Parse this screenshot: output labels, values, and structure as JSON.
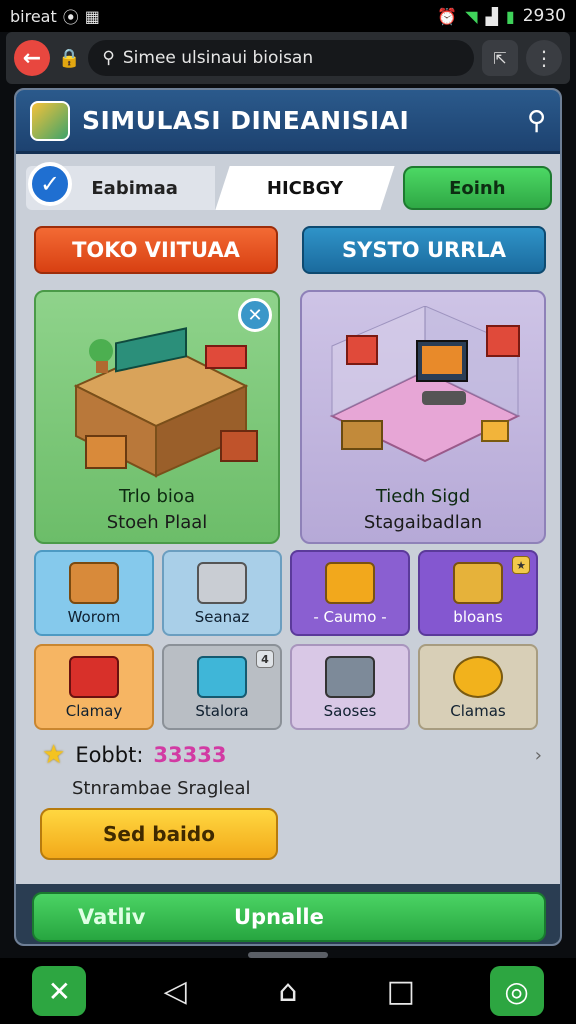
{
  "status_bar": {
    "carrier": "bireat",
    "time": "2930"
  },
  "browser": {
    "url": "Simee ulsinaui bioisan"
  },
  "app": {
    "title": "SIMULASI DINEANISIAI",
    "tabs": [
      "Eabimaa",
      "HICBGY",
      "Eoinh"
    ],
    "categories": [
      "TOKO VIITUAA",
      "SYSTO URRLA"
    ],
    "big_cards": [
      {
        "title": "Trlo bioa",
        "subtitle": "Stoeh Plaal"
      },
      {
        "title": "Tiedh Sigd",
        "subtitle": "Stagaibadlan"
      }
    ],
    "tiles": [
      {
        "label": "Worom"
      },
      {
        "label": "Seanaz"
      },
      {
        "label": "- Caumo -"
      },
      {
        "label": "bloans"
      },
      {
        "label": "Clamay"
      },
      {
        "label": "Stalora"
      },
      {
        "label": "Saoses"
      },
      {
        "label": "Clamas"
      }
    ],
    "info": {
      "label": "Eobbt:",
      "score": "33333",
      "description": "Stnrambae Sragleal"
    },
    "send_button": "Sed baido",
    "update_bar": {
      "left": "Vatliv",
      "right": "Upnalle"
    }
  },
  "colors": {
    "header": "#1d4270",
    "accent_green": "#2fa845",
    "accent_red": "#d84012",
    "accent_blue": "#1b6b9e"
  }
}
